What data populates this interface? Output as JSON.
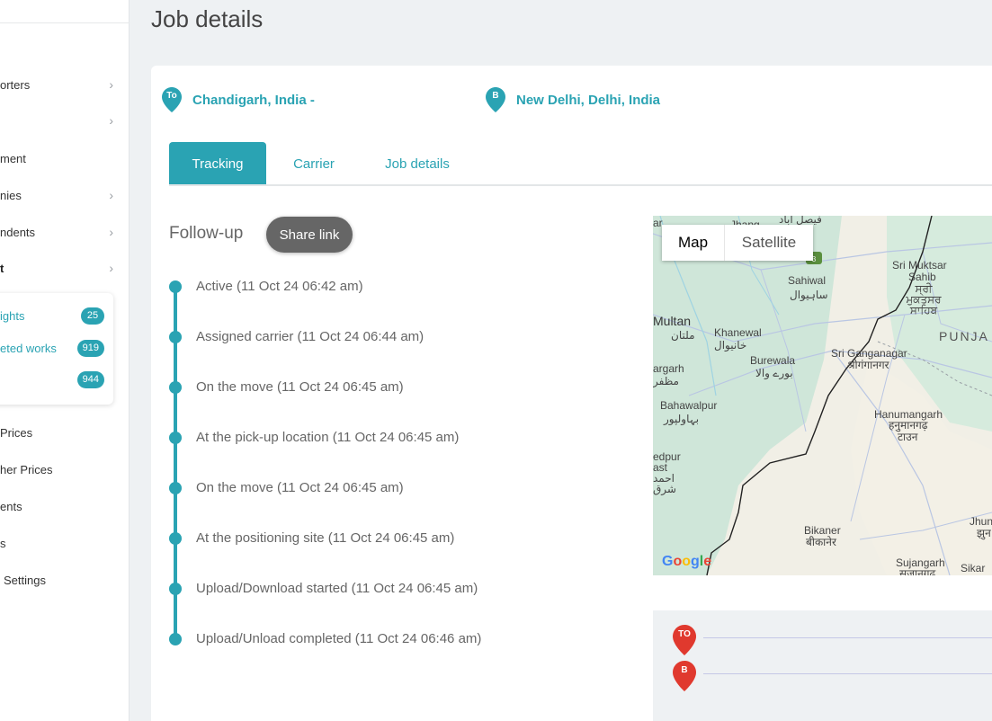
{
  "page": {
    "title": "Job details"
  },
  "sidebar": {
    "items": [
      {
        "label": "orters",
        "chevron": true,
        "bold": false
      },
      {
        "label": "",
        "chevron": true,
        "bold": false
      },
      {
        "label": "ment",
        "chevron": false,
        "bold": false
      },
      {
        "label": "nies",
        "chevron": true,
        "bold": false
      },
      {
        "label": "ndents",
        "chevron": true,
        "bold": false
      },
      {
        "label": "t",
        "chevron": true,
        "bold": true
      }
    ],
    "submenu": [
      {
        "label": "ights",
        "count": "25"
      },
      {
        "label": "eted works",
        "count": "919"
      },
      {
        "label": "",
        "count": "944"
      }
    ],
    "lower_items": [
      {
        "label": "Prices"
      },
      {
        "label": "her Prices"
      },
      {
        "label": "ents"
      },
      {
        "label": "s"
      },
      {
        "label": "Settings"
      }
    ]
  },
  "route": {
    "origin": {
      "pin": "To",
      "label": "Chandigarh, India  -"
    },
    "destination": {
      "pin": "B",
      "label": "New Delhi, Delhi, India"
    }
  },
  "tabs": [
    {
      "label": "Tracking",
      "active": true
    },
    {
      "label": "Carrier",
      "active": false
    },
    {
      "label": "Job details",
      "active": false
    }
  ],
  "followup": {
    "label": "Follow-up",
    "share_button": "Share link",
    "events": [
      "Active (11 Oct 24 06:42 am)",
      "Assigned carrier (11 Oct 24 06:44 am)",
      "On the move (11 Oct 24 06:45 am)",
      "At the pick-up location (11 Oct 24 06:45 am)",
      "On the move (11 Oct 24 06:45 am)",
      "At the positioning site (11 Oct 24 06:45 am)",
      "Upload/Download started (11 Oct 24 06:45 am)",
      "Upload/Unload completed (11 Oct 24 06:46 am)"
    ]
  },
  "map": {
    "toggle": {
      "map": "Map",
      "satellite": "Satellite"
    },
    "places": {
      "multan": "Multan",
      "multan_ur": "ملتان",
      "khanewal": "Khanewal",
      "khanewal_ur": "خانیوال",
      "sahiwal": "Sahiwal",
      "sahiwal_ur": "ساہیوال",
      "burewala": "Burewala",
      "burewala_ur": "بورے والا",
      "bahawalpur": "Bahawalpur",
      "bahawalpur_ur": "بہاولپور",
      "sri_muktsar": "Sri Muktsar",
      "sahib": "Sahib",
      "sri_muktsar_pa": "ਸ੍ਰੀ ਮੁਕਤਸਰ ਸਾਹਿਬ",
      "punjab": "PUNJA",
      "sri_ganganagar": "Sri Ganganagar",
      "sri_ganganagar_hi": "श्रीगंगानगर",
      "hanumangarh": "Hanumangarh",
      "hanumangarh_hi": "हनुमानगढ़",
      "hanumangarh_town": "टाउन",
      "bikaner": "Bikaner",
      "bikaner_hi": "बीकानेर",
      "sujangarh": "Sujangarh",
      "sujangarh_hi": "सुजानगढ़",
      "sikar": "Sikar",
      "jhang": "Jhang",
      "edge_ar": "ar",
      "edge_argarh": "argarh",
      "edge_argarh_ur": "مظفر",
      "edge_edpur": "edpur",
      "edge_ast": "ast",
      "edge_ast_ur": "احمد",
      "edge_ast_ur2": "شرق",
      "jhun": "Jhun",
      "jhun_hi": "झुन",
      "top_ur": "فيصل آباد",
      "road_shield": "3"
    },
    "logo": "Google"
  },
  "route_panel": {
    "pins": [
      {
        "label": "TO"
      },
      {
        "label": "B"
      }
    ]
  },
  "colors": {
    "accent": "#2aa3b3",
    "pin_red": "#e0392e",
    "share_button": "#666666"
  }
}
